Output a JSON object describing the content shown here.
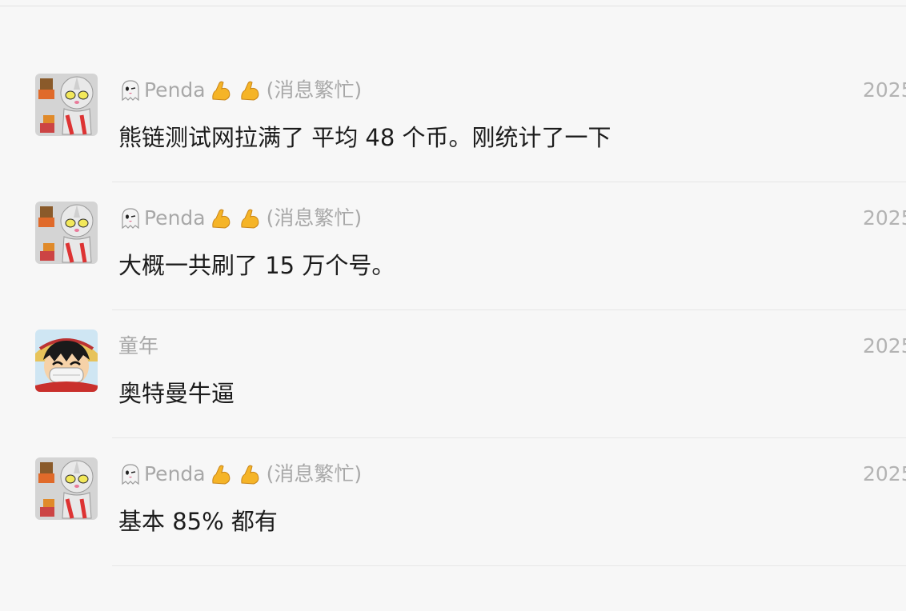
{
  "messages": [
    {
      "avatar": "ultraman-avatar",
      "sender_prefix_icon": "ghost-icon",
      "sender_name": "Penda",
      "sender_suffix_icons": [
        "flexed-biceps-icon",
        "flexed-biceps-icon"
      ],
      "sender_status": "(消息繁忙)",
      "time": "2025",
      "text": "熊链测试网拉满了 平均 48 个币。刚统计了一下"
    },
    {
      "avatar": "ultraman-avatar",
      "sender_prefix_icon": "ghost-icon",
      "sender_name": "Penda",
      "sender_suffix_icons": [
        "flexed-biceps-icon",
        "flexed-biceps-icon"
      ],
      "sender_status": "(消息繁忙)",
      "time": "2025",
      "text": "大概一共刷了 15 万个号。"
    },
    {
      "avatar": "luffy-avatar",
      "sender_name": "童年",
      "time": "2025",
      "text": "奥特曼牛逼"
    },
    {
      "avatar": "ultraman-avatar",
      "sender_prefix_icon": "ghost-icon",
      "sender_name": "Penda",
      "sender_suffix_icons": [
        "flexed-biceps-icon",
        "flexed-biceps-icon"
      ],
      "sender_status": "(消息繁忙)",
      "time": "2025",
      "text": "基本 85% 都有"
    }
  ]
}
